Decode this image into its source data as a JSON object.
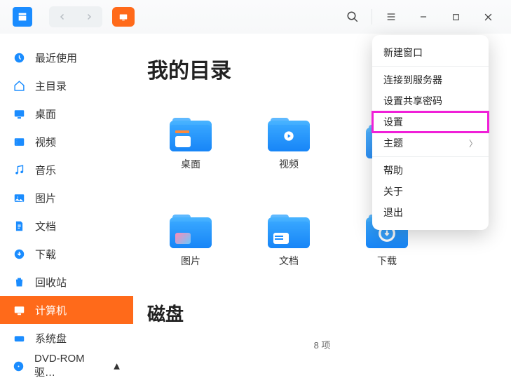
{
  "sidebar": {
    "items": [
      {
        "label": "最近使用",
        "name": "recent"
      },
      {
        "label": "主目录",
        "name": "home"
      },
      {
        "label": "桌面",
        "name": "desktop"
      },
      {
        "label": "视频",
        "name": "videos"
      },
      {
        "label": "音乐",
        "name": "music"
      },
      {
        "label": "图片",
        "name": "pictures"
      },
      {
        "label": "文档",
        "name": "documents"
      },
      {
        "label": "下载",
        "name": "downloads"
      },
      {
        "label": "回收站",
        "name": "trash"
      },
      {
        "label": "计算机",
        "name": "computer"
      },
      {
        "label": "系统盘",
        "name": "system-disk"
      },
      {
        "label": "DVD-ROM 驱…",
        "name": "dvd"
      }
    ]
  },
  "main": {
    "heading": "我的目录",
    "tiles": [
      {
        "label": "桌面",
        "icon": "desktop"
      },
      {
        "label": "视频",
        "icon": "videos"
      },
      {
        "label": "",
        "icon": "hidden"
      },
      {
        "label": "图片",
        "icon": "pictures"
      },
      {
        "label": "文档",
        "icon": "documents"
      },
      {
        "label": "下载",
        "icon": "downloads"
      }
    ],
    "heading2": "磁盘",
    "footer": "8 项"
  },
  "menu": {
    "items": [
      {
        "label": "新建窗口",
        "name": "new-window"
      },
      {
        "label": "连接到服务器",
        "name": "connect-server"
      },
      {
        "label": "设置共享密码",
        "name": "share-password"
      },
      {
        "label": "设置",
        "name": "settings",
        "highlight": true
      },
      {
        "label": "主题",
        "name": "theme",
        "submenu": true
      },
      {
        "label": "帮助",
        "name": "help"
      },
      {
        "label": "关于",
        "name": "about"
      },
      {
        "label": "退出",
        "name": "exit"
      }
    ],
    "sep_after": [
      0,
      4
    ]
  }
}
